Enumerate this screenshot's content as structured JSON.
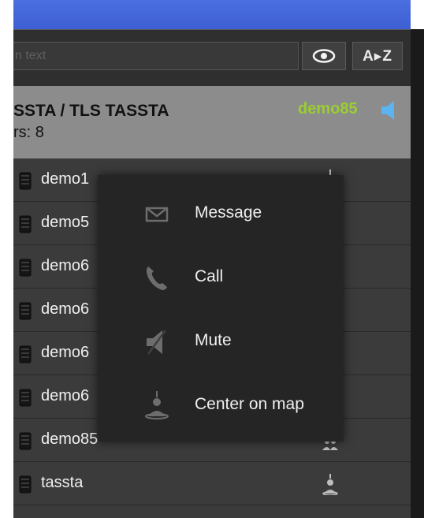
{
  "search": {
    "placeholder_fragment": "n text"
  },
  "toolbar": {
    "sort_label": "A▸Z",
    "visibility_icon": "eye-icon"
  },
  "group": {
    "name": "SSTA / TLS TASSTA",
    "members_label": "rs: 8",
    "current_user": "demo85",
    "current_user_color": "#9acd32",
    "speaker_icon": "speaker-icon"
  },
  "rows": [
    {
      "name": "demo1",
      "icon": "handheld-radio-icon",
      "status_icon": "antenna-icon"
    },
    {
      "name": "demo5",
      "icon": "handheld-radio-icon"
    },
    {
      "name": "demo6",
      "icon": "handheld-radio-icon"
    },
    {
      "name": "demo6",
      "icon": "handheld-radio-icon"
    },
    {
      "name": "demo6",
      "icon": "handheld-radio-icon"
    },
    {
      "name": "demo6",
      "icon": "handheld-radio-icon"
    },
    {
      "name": "demo85",
      "icon": "handheld-radio-icon",
      "status_icon": "users-icon"
    },
    {
      "name": "tassta",
      "icon": "handheld-radio-icon",
      "status_icon": "user-location-icon"
    }
  ],
  "context_menu": [
    {
      "label": "Message",
      "icon": "envelope-icon"
    },
    {
      "label": "Call",
      "icon": "phone-icon"
    },
    {
      "label": "Mute",
      "icon": "mute-icon"
    },
    {
      "label": "Center on map",
      "icon": "map-pin-user-icon"
    }
  ]
}
